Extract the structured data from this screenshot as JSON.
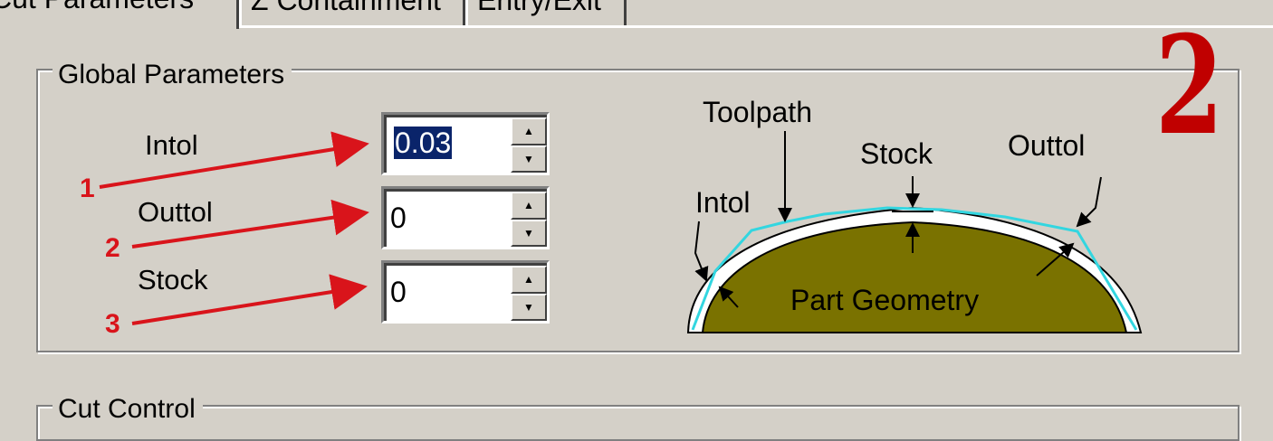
{
  "tabs": [
    {
      "label": "Cut Parameters",
      "active": true
    },
    {
      "label": "Z Containment",
      "active": false
    },
    {
      "label": "Entry/Exit",
      "active": false
    }
  ],
  "global_group": {
    "title": "Global Parameters",
    "fields": [
      {
        "label": "Intol",
        "value": "0.03",
        "selected": true
      },
      {
        "label": "Outtol",
        "value": "0",
        "selected": false
      },
      {
        "label": "Stock",
        "value": "0",
        "selected": false
      }
    ]
  },
  "cut_group": {
    "title": "Cut Control"
  },
  "annotations": {
    "markers": [
      "1",
      "2",
      "3"
    ],
    "step_number": "2",
    "color": "#d9141b"
  },
  "diagram": {
    "labels": {
      "toolpath": "Toolpath",
      "stock": "Stock",
      "outtol": "Outtol",
      "intol": "Intol",
      "part_geometry": "Part Geometry"
    },
    "colors": {
      "part_fill": "#7a7200",
      "toolpath": "#33d6e0",
      "stock_band": "#ffffff"
    }
  },
  "colors": {
    "window_bg": "#d4d0c8",
    "selection_bg": "#0a246a"
  }
}
